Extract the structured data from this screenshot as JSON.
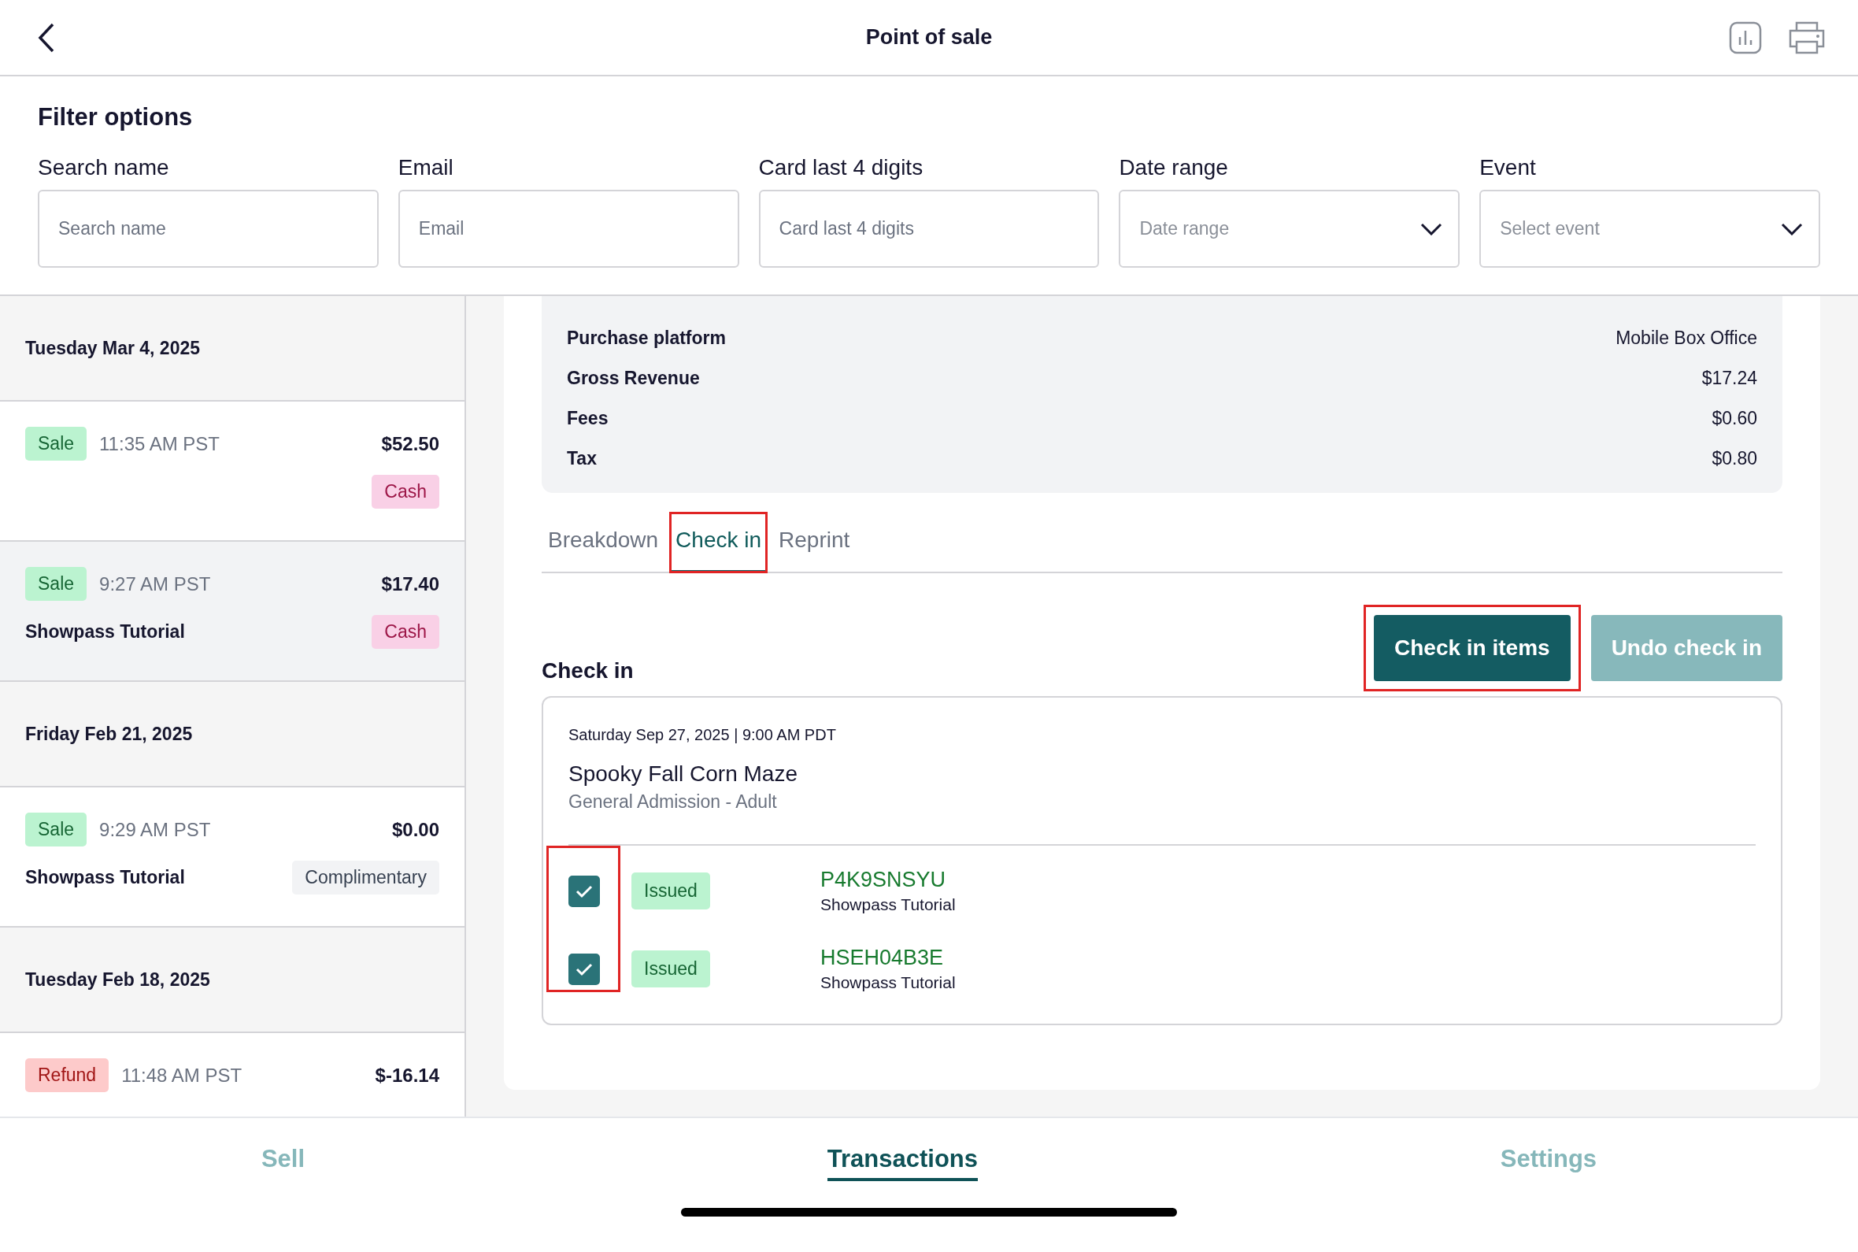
{
  "header": {
    "title": "Point of sale"
  },
  "filters": {
    "title": "Filter options",
    "fields": [
      {
        "kind": "text",
        "label": "Search name",
        "placeholder": "Search name"
      },
      {
        "kind": "text",
        "label": "Email",
        "placeholder": "Email"
      },
      {
        "kind": "text",
        "label": "Card last 4 digits",
        "placeholder": "Card last 4 digits"
      },
      {
        "kind": "select",
        "label": "Date range",
        "placeholder": "Date range"
      },
      {
        "kind": "select",
        "label": "Event",
        "placeholder": "Select event"
      }
    ]
  },
  "transactions": [
    {
      "kind": "date",
      "label": "Tuesday Mar 4, 2025"
    },
    {
      "kind": "entry",
      "type": "Sale",
      "time": "11:35 AM PST",
      "amount": "$52.50",
      "payment": {
        "label": "Cash",
        "color": "#f9d0e6"
      },
      "selected": false
    },
    {
      "kind": "entry",
      "type": "Sale",
      "time": "9:27 AM PST",
      "amount": "$17.40",
      "event": "Showpass Tutorial",
      "payment": {
        "label": "Cash",
        "color": "#f9d0e6"
      },
      "selected": true
    },
    {
      "kind": "date",
      "label": "Friday Feb 21, 2025"
    },
    {
      "kind": "entry",
      "type": "Sale",
      "time": "9:29 AM PST",
      "amount": "$0.00",
      "event": "Showpass Tutorial",
      "payment": {
        "label": "Complimentary",
        "color": "#f2f3f5"
      },
      "selected": false
    },
    {
      "kind": "date",
      "label": "Tuesday Feb 18, 2025"
    },
    {
      "kind": "entry",
      "type": "Refund",
      "time": "11:48 AM PST",
      "amount": "$-16.14",
      "selected": false
    }
  ],
  "details": [
    {
      "label": "Purchase platform",
      "value": "Mobile Box Office"
    },
    {
      "label": "Gross Revenue",
      "value": "$17.24"
    },
    {
      "label": "Fees",
      "value": "$0.60"
    },
    {
      "label": "Tax",
      "value": "$0.80"
    }
  ],
  "tabs": [
    {
      "label": "Breakdown",
      "selected": false,
      "highlighted": false
    },
    {
      "label": "Check in",
      "selected": true,
      "highlighted": true
    },
    {
      "label": "Reprint",
      "selected": false,
      "highlighted": false
    }
  ],
  "check_in": {
    "title": "Check in",
    "buttons": [
      {
        "label": "Check in items",
        "disabled": false,
        "highlighted": true
      },
      {
        "label": "Undo check in",
        "disabled": true,
        "highlighted": false
      }
    ],
    "event": {
      "datetime": "Saturday Sep 27, 2025 | 9:00 AM PDT",
      "name": "Spooky Fall Corn Maze",
      "ticket_type": "General Admission - Adult"
    },
    "checkboxes_highlighted": true,
    "tickets": [
      {
        "checked": true,
        "status": "Issued",
        "code": "P4K9SNSYU",
        "event": "Showpass Tutorial"
      },
      {
        "checked": true,
        "status": "Issued",
        "code": "HSEH04B3E",
        "event": "Showpass Tutorial"
      }
    ]
  },
  "bottom_nav": [
    {
      "label": "Sell",
      "selected": false
    },
    {
      "label": "Transactions",
      "selected": true
    },
    {
      "label": "Settings",
      "selected": false
    }
  ]
}
